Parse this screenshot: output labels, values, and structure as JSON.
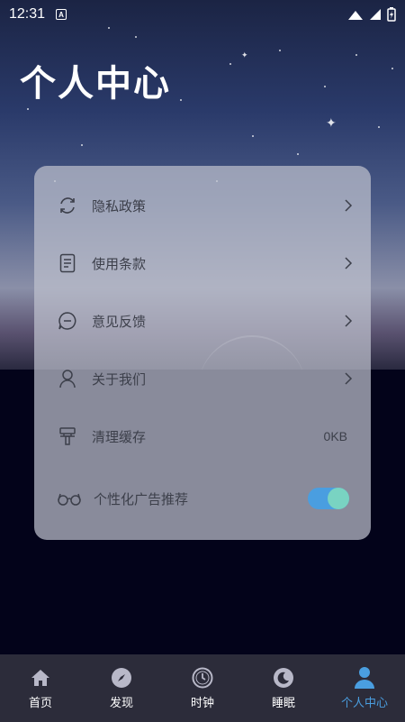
{
  "status_bar": {
    "time": "12:31",
    "notification_badge": "A"
  },
  "page_title": "个人中心",
  "menu": {
    "items": [
      {
        "label": "隐私政策",
        "icon": "refresh-cycle-icon"
      },
      {
        "label": "使用条款",
        "icon": "document-icon"
      },
      {
        "label": "意见反馈",
        "icon": "chat-bubble-icon"
      },
      {
        "label": "关于我们",
        "icon": "person-icon"
      }
    ],
    "clear_cache": {
      "label": "清理缓存",
      "value": "0KB",
      "icon": "brush-icon"
    },
    "personalized_ads": {
      "label": "个性化广告推荐",
      "enabled": true,
      "icon": "glasses-icon"
    }
  },
  "bottom_nav": {
    "items": [
      {
        "label": "首页",
        "icon": "home-icon"
      },
      {
        "label": "发现",
        "icon": "compass-icon"
      },
      {
        "label": "时钟",
        "icon": "clock-icon"
      },
      {
        "label": "睡眠",
        "icon": "moon-icon"
      },
      {
        "label": "个人中心",
        "icon": "user-icon"
      }
    ],
    "active_index": 4
  },
  "colors": {
    "accent": "#4a9ee0",
    "toggle_knob": "#79d3c2",
    "nav_bg": "#2c2c3a",
    "card_text": "#3c3f4a"
  }
}
